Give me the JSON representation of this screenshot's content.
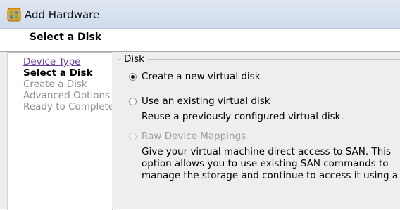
{
  "window": {
    "title": "Add Hardware"
  },
  "header": {
    "title": "Select a Disk"
  },
  "nav": {
    "items": [
      {
        "label": "Device Type",
        "state": "link"
      },
      {
        "label": "Select a Disk",
        "state": "current"
      },
      {
        "label": "Create a Disk",
        "state": "disabled"
      },
      {
        "label": "Advanced Options",
        "state": "disabled"
      },
      {
        "label": "Ready to Complete",
        "state": "disabled"
      }
    ]
  },
  "disk_group": {
    "legend": "Disk",
    "options": [
      {
        "label": "Create a new virtual disk",
        "selected": true,
        "enabled": true,
        "description": []
      },
      {
        "label": "Use an existing virtual disk",
        "selected": false,
        "enabled": true,
        "description": [
          "Reuse a previously configured virtual disk."
        ]
      },
      {
        "label": "Raw Device Mappings",
        "selected": false,
        "enabled": false,
        "description": [
          "Give your virtual machine direct access to SAN. This",
          "option allows you to use existing SAN commands to",
          "manage the storage and continue to access it using a"
        ]
      }
    ]
  },
  "colors": {
    "titlebar": "#dfe8f2",
    "link": "#6b3fa0",
    "disabled_text": "#8d8d8d",
    "panel_bg": "#eeeeee"
  }
}
